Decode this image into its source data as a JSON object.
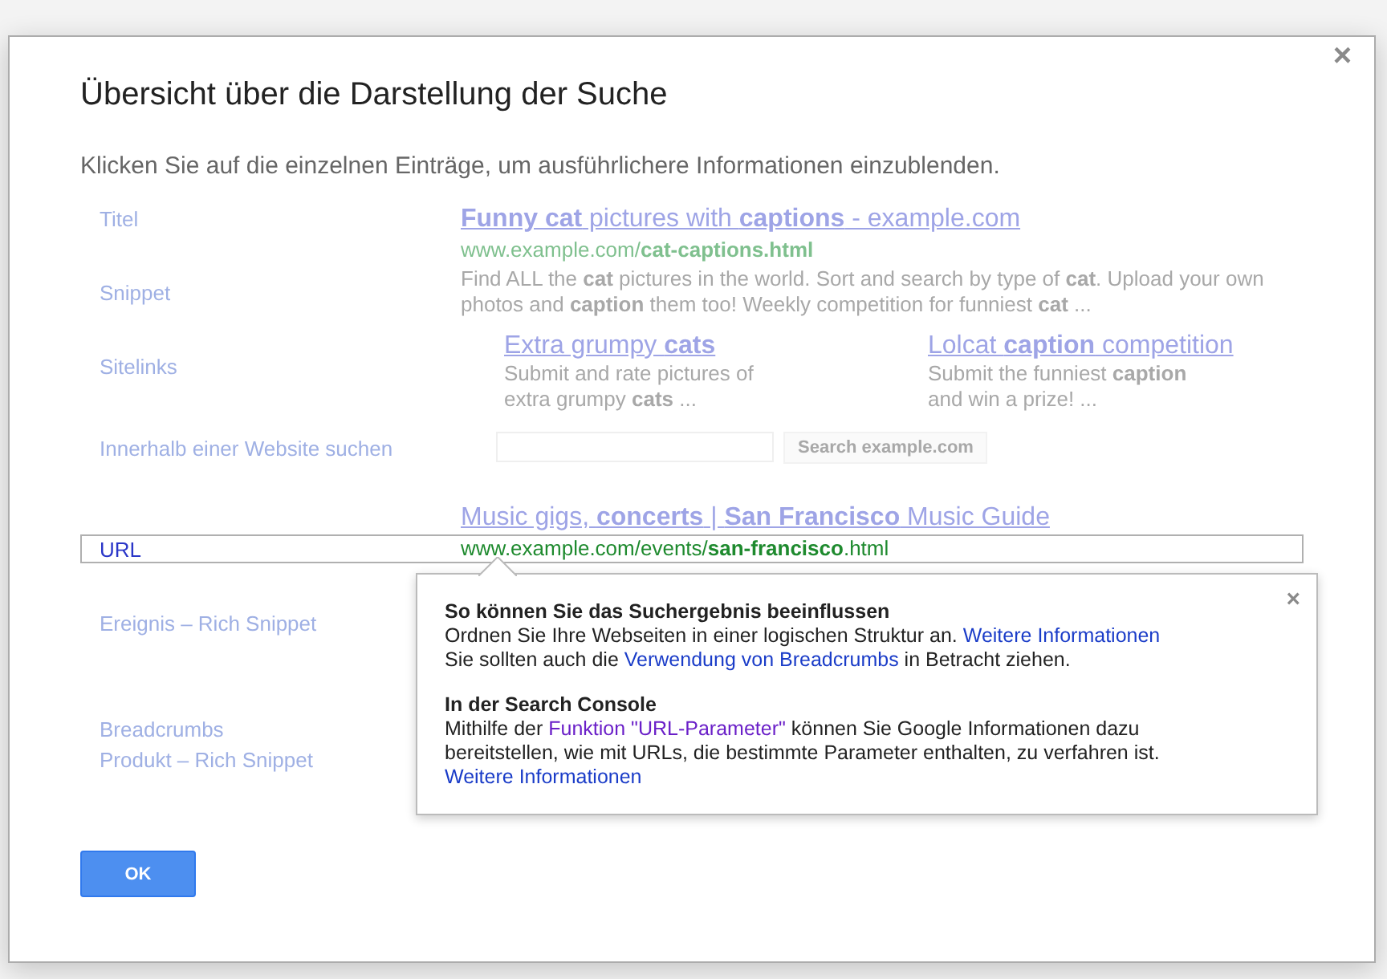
{
  "dialog": {
    "title": "Übersicht über die Darstellung der Suche",
    "subtitle": "Klicken Sie auf die einzelnen Einträge, um ausführlichere Informationen einzublenden.",
    "close": "×",
    "rows": [
      {
        "kind": "title",
        "label": "Titel",
        "selected": false,
        "text": "**Funny cat** pictures with **captions** - example.com"
      },
      {
        "kind": "url",
        "selected": false,
        "text": "www.example.com/**cat-captions.html**"
      },
      {
        "kind": "snippet",
        "label": "Snippet",
        "selected": false,
        "text": "Find ALL the **cat** pictures in the world. Sort and search by type of **cat**. Upload your own photos and **caption** them too! Weekly competition for funniest **cat** ..."
      },
      {
        "kind": "sitelinks",
        "label": "Sitelinks",
        "selected": false,
        "links": [
          {
            "title": "Extra grumpy **cats**",
            "text": "Submit and rate pictures of extra grumpy **cats** ..."
          },
          {
            "title": "Lolcat **caption** competition",
            "text": "Submit the funniest **caption** and win a prize! ..."
          }
        ]
      },
      {
        "kind": "search",
        "label": "Innerhalb einer Website suchen",
        "selected": false,
        "button": "Search example.com"
      },
      {
        "kind": "title",
        "selected": false,
        "text": "Music gigs, **concerts** | **San Francisco** Music Guide"
      },
      {
        "kind": "url",
        "label": "URL",
        "selected": true,
        "text": "www.example.com/events/**san-francisco**.html"
      },
      {
        "kind": "covered",
        "label": "Ereignis – Rich Snippet",
        "selected": false
      },
      {
        "kind": "covered",
        "label": "Breadcrumbs",
        "selected": false
      },
      {
        "kind": "covered",
        "label": "Produkt – Rich Snippet",
        "selected": false
      }
    ],
    "popup": {
      "close": "×",
      "sections": [
        {
          "heading": "So können Sie das Suchergebnis beeinflussen",
          "paragraphs": [
            [
              {
                "text": "Ordnen Sie Ihre Webseiten in einer logischen Struktur an. "
              },
              {
                "text": "Weitere Informationen",
                "link": true,
                "visited": false
              }
            ],
            [
              {
                "text": "Sie sollten auch die "
              },
              {
                "text": "Verwendung von Breadcrumbs",
                "link": true,
                "visited": false
              },
              {
                "text": " in Betracht ziehen."
              }
            ]
          ]
        },
        {
          "heading": "In der Search Console",
          "paragraphs": [
            [
              {
                "text": "Mithilfe der "
              },
              {
                "text": "Funktion \"URL-Parameter\"",
                "link": true,
                "visited": true
              },
              {
                "text": " können Sie Google Informationen dazu bereitstellen, wie mit URLs, die bestimmte Parameter enthalten, zu verfahren ist."
              }
            ],
            [
              {
                "text": "Weitere Informationen",
                "link": true,
                "visited": false
              }
            ]
          ]
        }
      ]
    },
    "ok_button": "OK"
  }
}
